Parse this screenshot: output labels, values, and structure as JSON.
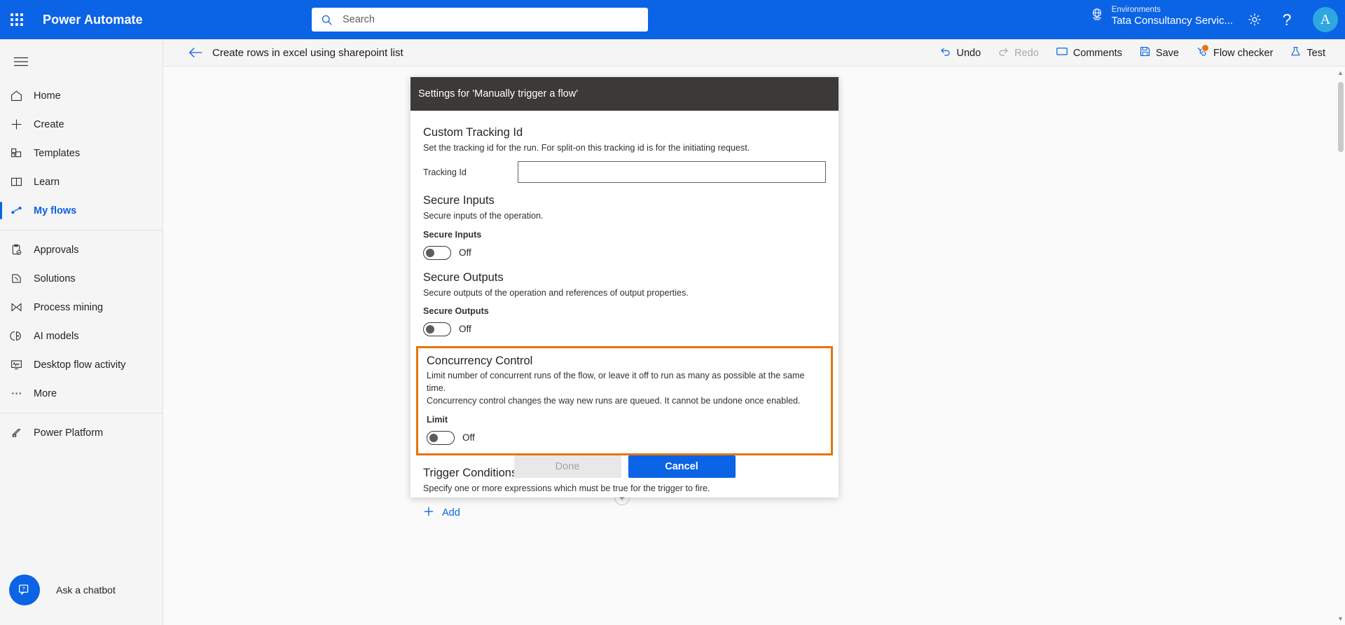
{
  "topbar": {
    "waffle_icon": "app-launcher-icon",
    "brand": "Power Automate",
    "search": {
      "placeholder": "Search",
      "value": "",
      "icon": "search-icon"
    },
    "environment": {
      "icon": "globe-environment-icon",
      "label": "Environments",
      "name": "Tata Consultancy Servic..."
    },
    "gear_icon": "gear-icon",
    "help_icon": "help-question-icon",
    "avatar_initial": "A",
    "brand_color": "#0b63e5"
  },
  "sidebar": {
    "hamburger_icon": "hamburger-menu-icon",
    "items": [
      {
        "label": "Home",
        "icon": "home-icon",
        "selected": false
      },
      {
        "label": "Create",
        "icon": "plus-icon",
        "selected": false
      },
      {
        "label": "Templates",
        "icon": "templates-icon",
        "selected": false
      },
      {
        "label": "Learn",
        "icon": "book-icon",
        "selected": false
      },
      {
        "label": "My flows",
        "icon": "flow-icon",
        "selected": true
      },
      {
        "label": "Approvals",
        "icon": "approvals-icon",
        "selected": false
      },
      {
        "label": "Solutions",
        "icon": "solutions-icon",
        "selected": false
      },
      {
        "label": "Process mining",
        "icon": "process-mining-icon",
        "selected": false
      },
      {
        "label": "AI models",
        "icon": "ai-models-icon",
        "selected": false
      },
      {
        "label": "Desktop flow activity",
        "icon": "desktop-flow-icon",
        "selected": false
      },
      {
        "label": "More",
        "icon": "ellipsis-icon",
        "selected": false
      },
      {
        "label": "Power Platform",
        "icon": "power-platform-icon",
        "selected": false
      }
    ],
    "chatbot": {
      "label": "Ask a chatbot",
      "icon": "chatbot-icon"
    },
    "selected_color": "#0b63e5"
  },
  "commandbar": {
    "back_icon": "back-arrow-icon",
    "flow_title": "Create rows in excel using sharepoint list",
    "actions": [
      {
        "label": "Undo",
        "icon": "undo-icon",
        "disabled": false,
        "badge": false
      },
      {
        "label": "Redo",
        "icon": "redo-icon",
        "disabled": true,
        "badge": false
      },
      {
        "label": "Comments",
        "icon": "comment-icon",
        "disabled": false,
        "badge": false
      },
      {
        "label": "Save",
        "icon": "save-disk-icon",
        "disabled": false,
        "badge": false
      },
      {
        "label": "Flow checker",
        "icon": "flow-checker-icon",
        "disabled": false,
        "badge": true
      },
      {
        "label": "Test",
        "icon": "test-flask-icon",
        "disabled": false,
        "badge": false
      }
    ],
    "badge_color": "#e8730c"
  },
  "dialog": {
    "title": "Settings for 'Manually trigger a flow'",
    "header_color": "#3b3a39",
    "sections": {
      "tracking": {
        "title": "Custom Tracking Id",
        "description": "Set the tracking id for the run. For split-on this tracking id is for the initiating request.",
        "field_label": "Tracking Id",
        "value": "",
        "placeholder": ""
      },
      "secure_inputs": {
        "title": "Secure Inputs",
        "description": "Secure inputs of the operation.",
        "field_label": "Secure Inputs",
        "toggle_state": "Off"
      },
      "secure_outputs": {
        "title": "Secure Outputs",
        "description": "Secure outputs of the operation and references of output properties.",
        "field_label": "Secure Outputs",
        "toggle_state": "Off"
      },
      "concurrency": {
        "title": "Concurrency Control",
        "description_line1": "Limit number of concurrent runs of the flow, or leave it off to run as many as possible at the same time.",
        "description_line2": "Concurrency control changes the way new runs are queued. It cannot be undone once enabled.",
        "field_label": "Limit",
        "toggle_state": "Off",
        "highlight_color": "#e8730c"
      },
      "trigger_conditions": {
        "title": "Trigger Conditions",
        "description": "Specify one or more expressions which must be true for the trigger to fire.",
        "add_label": "Add",
        "add_icon": "plus-icon"
      }
    },
    "footer": {
      "done_label": "Done",
      "cancel_label": "Cancel",
      "done_disabled": true,
      "cancel_color": "#0b63e5"
    }
  },
  "canvas": {
    "add_node_icon": "plus-node-icon"
  }
}
